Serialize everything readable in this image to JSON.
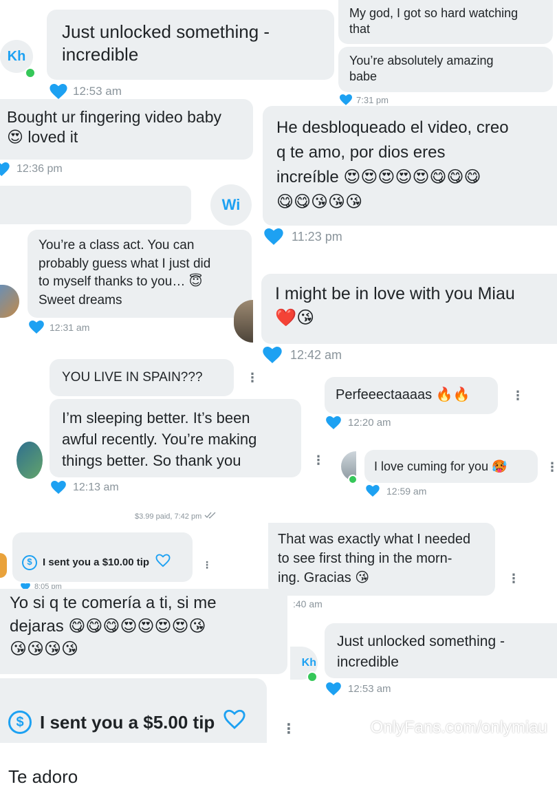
{
  "watermark": "OnlyFans.com/onlymiau",
  "colors": {
    "accent": "#1da1f2",
    "bubble": "#eceff1",
    "meta": "#8a949b",
    "online": "#35c759"
  },
  "panels": {
    "p1": {
      "avatar": "Kh",
      "text": "Just unlocked something -\nincredible",
      "time": "12:53 am"
    },
    "p2": {
      "line1": "My god, I got so hard watching\nthat",
      "line2": "You’re absolutely amazing\nbabe",
      "time": "7:31 pm"
    },
    "p3": {
      "text": "Bought ur fingering video baby\n😍 loved it",
      "time": "12:36 pm"
    },
    "p4": {
      "avatar": "Wi"
    },
    "p5": {
      "text": "He desbloqueado el video, creo\nq te amo, por dios eres\nincreíble 😍😍😍😍😍😋😋😋\n😋😋😘😘😘",
      "time": "11:23 pm"
    },
    "p6": {
      "text": "You’re a class act. You can\nprobably guess what I just did\nto myself thanks to you… 😇\nSweet dreams",
      "time": "12:31 am"
    },
    "p7": {
      "text": "I might be in love with you Miau\n❤️😘",
      "time": "12:42 am"
    },
    "p8": {
      "line1": "YOU LIVE IN SPAIN???",
      "line2": "I’m sleeping better. It’s been\nawful recently. You’re making\nthings better. So thank you",
      "time": "12:13 am",
      "kebab": "⋮"
    },
    "p9": {
      "text": "Perfeeectaaaas 🔥🔥",
      "time": "12:20 am",
      "kebab": "⋮"
    },
    "p10": {
      "text": "I love cuming for you 🥵",
      "time": "12:59 am",
      "kebab": "⋮"
    },
    "p11": {
      "paid": "$3.99 paid, 7:42 pm"
    },
    "p12": {
      "tip": "I sent you a $10.00 tip",
      "emoji": "😍",
      "time": "8:05 pm",
      "kebab": "⋮"
    },
    "p13": {
      "text": "That was exactly what I needed\nto see first thing in the morn-\ning. Gracias 😘",
      "time": ":40 am",
      "kebab": "⋮"
    },
    "p14": {
      "text": "Yo si q te comería a ti, si me\ndejaras 😋😋😋😍😍😍😍😘\n😘😘😘😘"
    },
    "p15": {
      "avatar": "Kh",
      "text": "Just unlocked something -\nincredible",
      "time": "12:53 am"
    },
    "p16": {
      "tip": "I sent you a $5.00 tip",
      "text": "Te adoro",
      "kebab": "⋮"
    }
  }
}
